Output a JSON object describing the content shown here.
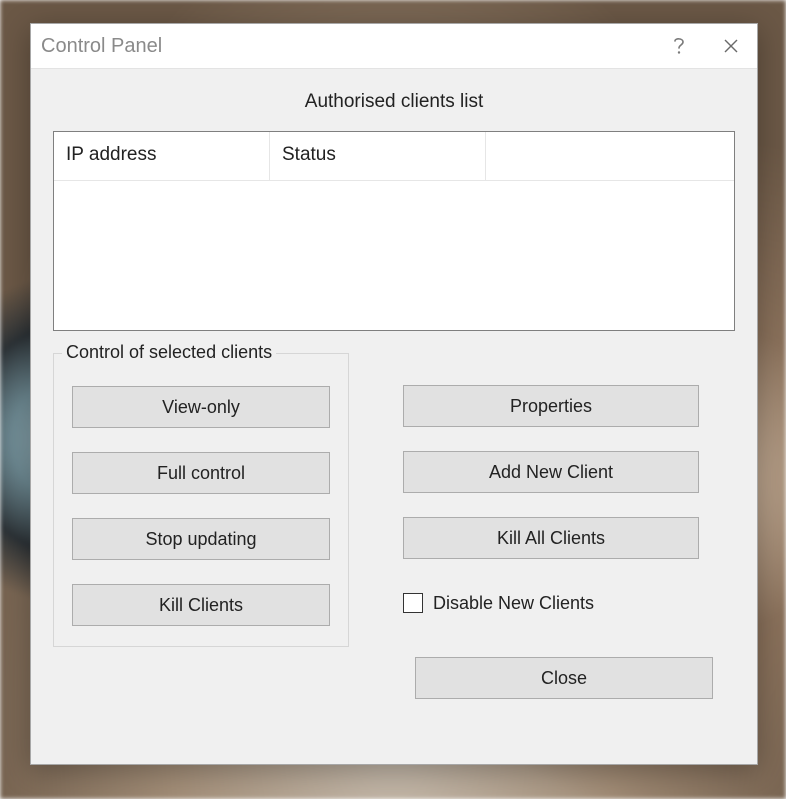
{
  "window": {
    "title": "Control Panel"
  },
  "list": {
    "label": "Authorised clients list",
    "columns": [
      "IP address",
      "Status",
      ""
    ]
  },
  "group": {
    "legend": "Control of selected clients",
    "view_only": "View-only",
    "full_control": "Full control",
    "stop_updating": "Stop updating",
    "kill_clients": "Kill Clients"
  },
  "right": {
    "properties": "Properties",
    "add_new_client": "Add New Client",
    "kill_all_clients": "Kill All Clients",
    "disable_new_clients": "Disable New Clients"
  },
  "footer": {
    "close": "Close"
  }
}
